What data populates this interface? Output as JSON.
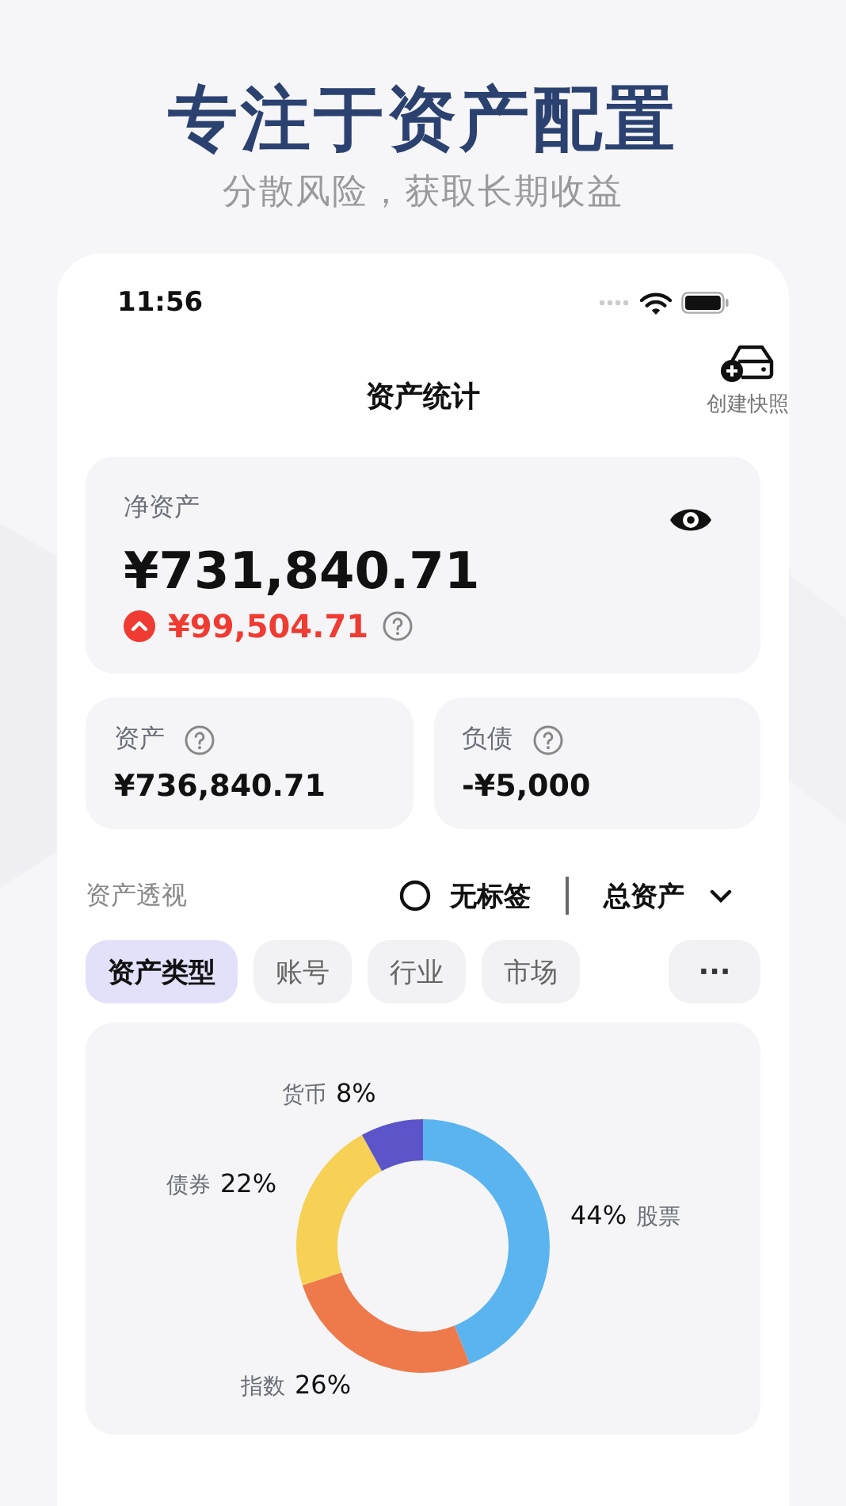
{
  "headline": {
    "title": "专注于资产配置",
    "subtitle": "分散风险，获取长期收益"
  },
  "status_bar": {
    "time": "11:56"
  },
  "nav": {
    "title": "资产统计",
    "snapshot_button": "创建快照"
  },
  "net_assets": {
    "label": "净资产",
    "amount": "¥731,840.71",
    "change": "¥99,504.71"
  },
  "summary": [
    {
      "label": "资产",
      "amount": "¥736,840.71"
    },
    {
      "label": "负债",
      "amount": "-¥5,000"
    }
  ],
  "overview": {
    "title": "资产透视",
    "tag_filter": "无标签",
    "scope": "总资产"
  },
  "tabs": [
    {
      "label": "资产类型",
      "selected": true
    },
    {
      "label": "账号",
      "selected": false
    },
    {
      "label": "行业",
      "selected": false
    },
    {
      "label": "市场",
      "selected": false
    }
  ],
  "more_button": "···",
  "chart_data": {
    "type": "donut",
    "categories": [
      "股票",
      "指数",
      "债券",
      "货币"
    ],
    "values": [
      44,
      26,
      22,
      8
    ],
    "value_labels": [
      "44%",
      "26%",
      "22%",
      "8%"
    ]
  }
}
